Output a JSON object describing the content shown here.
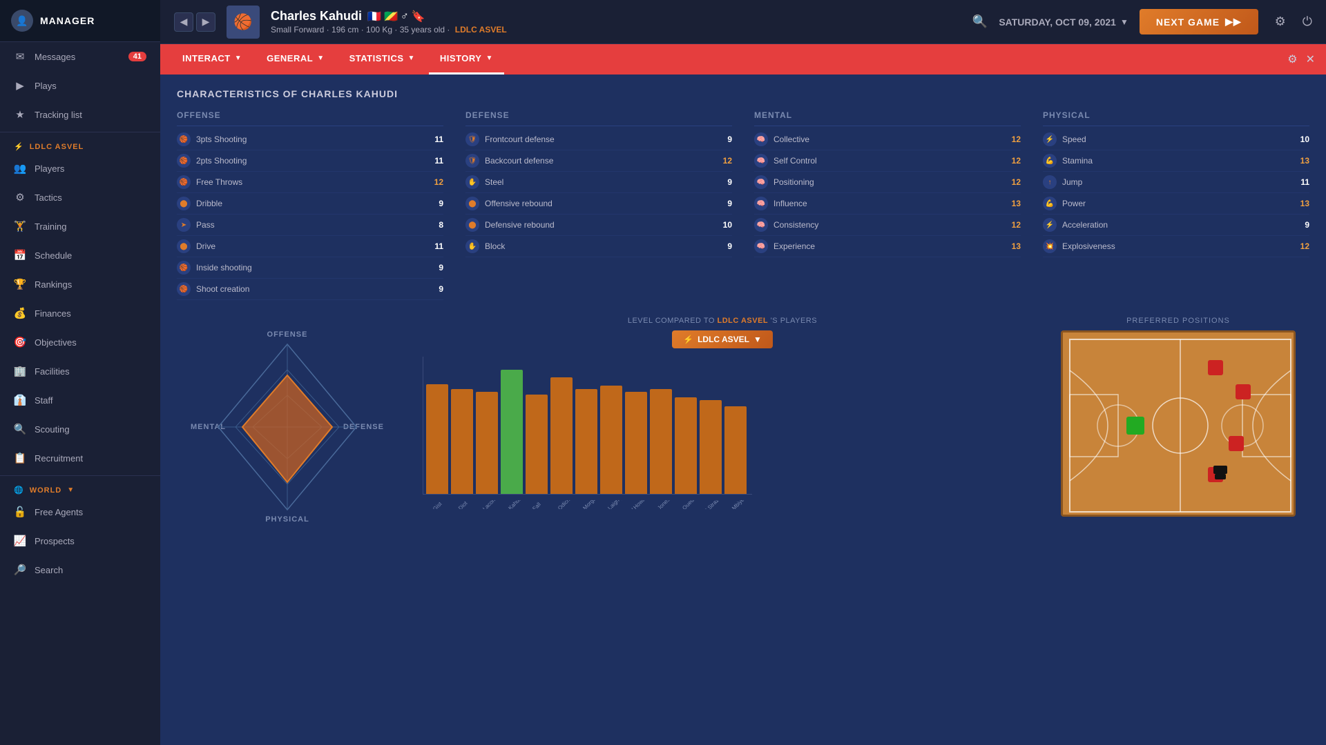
{
  "app": {
    "manager_label": "MANAGER",
    "manager_icon": "👤"
  },
  "sidebar": {
    "items": [
      {
        "id": "messages",
        "label": "Messages",
        "icon": "✉",
        "badge": "41",
        "active": false
      },
      {
        "id": "plays",
        "label": "Plays",
        "icon": "▶",
        "badge": null,
        "active": false
      },
      {
        "id": "tracking",
        "label": "Tracking list",
        "icon": "★",
        "badge": null,
        "active": false
      }
    ],
    "team_section": {
      "label": "LDLC ASVEL",
      "icon": "⚡"
    },
    "team_items": [
      {
        "id": "players",
        "label": "Players",
        "icon": "👥"
      },
      {
        "id": "tactics",
        "label": "Tactics",
        "icon": "⚙"
      },
      {
        "id": "training",
        "label": "Training",
        "icon": "🏋"
      },
      {
        "id": "schedule",
        "label": "Schedule",
        "icon": "📅"
      },
      {
        "id": "rankings",
        "label": "Rankings",
        "icon": "🏆"
      },
      {
        "id": "finances",
        "label": "Finances",
        "icon": "💰"
      },
      {
        "id": "objectives",
        "label": "Objectives",
        "icon": "🎯"
      },
      {
        "id": "facilities",
        "label": "Facilities",
        "icon": "🏢"
      },
      {
        "id": "staff",
        "label": "Staff",
        "icon": "👔"
      },
      {
        "id": "scouting",
        "label": "Scouting",
        "icon": "🔍"
      },
      {
        "id": "recruitment",
        "label": "Recruitment",
        "icon": "📋"
      }
    ],
    "world_section": {
      "label": "WORLD",
      "icon": "🌐"
    },
    "world_items": [
      {
        "id": "free-agents",
        "label": "Free Agents",
        "icon": "🔓"
      },
      {
        "id": "prospects",
        "label": "Prospects",
        "icon": "📈"
      },
      {
        "id": "search",
        "label": "Search",
        "icon": "🔎"
      }
    ]
  },
  "topbar": {
    "player_name": "Charles Kahudi",
    "player_icon": "🏀",
    "player_flags": [
      "🇫🇷",
      "🇨🇬"
    ],
    "player_gender": "♂",
    "player_details": "Small Forward · 196 cm · 100 Kg · 35 years old ·",
    "player_team": "LDLC ASVEL",
    "date": "SATURDAY, OCT 09, 2021",
    "next_game_label": "NEXT GAME",
    "next_game_arrow": "▶"
  },
  "nav_tabs": [
    {
      "id": "interact",
      "label": "INTERACT",
      "active": false,
      "dropdown": true
    },
    {
      "id": "general",
      "label": "GENERAL",
      "active": false,
      "dropdown": true
    },
    {
      "id": "statistics",
      "label": "STATISTICS",
      "active": false,
      "dropdown": true
    },
    {
      "id": "history",
      "label": "HISTORY",
      "active": true,
      "dropdown": true
    }
  ],
  "content": {
    "title": "CHARACTERISTICS OF CHARLES KAHUDI",
    "offense": {
      "header": "OFFENSE",
      "stats": [
        {
          "name": "3pts Shooting",
          "value": "11"
        },
        {
          "name": "2pts Shooting",
          "value": "11"
        },
        {
          "name": "Free Throws",
          "value": "12"
        },
        {
          "name": "Dribble",
          "value": "9"
        },
        {
          "name": "Pass",
          "value": "8"
        },
        {
          "name": "Drive",
          "value": "11"
        },
        {
          "name": "Inside shooting",
          "value": "9"
        },
        {
          "name": "Shoot creation",
          "value": "9"
        }
      ]
    },
    "defense": {
      "header": "DEFENSE",
      "stats": [
        {
          "name": "Frontcourt defense",
          "value": "9"
        },
        {
          "name": "Backcourt defense",
          "value": "12"
        },
        {
          "name": "Steel",
          "value": "9"
        },
        {
          "name": "Offensive rebound",
          "value": "9"
        },
        {
          "name": "Defensive rebound",
          "value": "10"
        },
        {
          "name": "Block",
          "value": "9"
        }
      ]
    },
    "mental": {
      "header": "MENTAL",
      "stats": [
        {
          "name": "Collective",
          "value": "12"
        },
        {
          "name": "Self Control",
          "value": "12"
        },
        {
          "name": "Positioning",
          "value": "12"
        },
        {
          "name": "Influence",
          "value": "13"
        },
        {
          "name": "Consistency",
          "value": "12"
        },
        {
          "name": "Experience",
          "value": "13"
        }
      ]
    },
    "physical": {
      "header": "PHYSICAL",
      "stats": [
        {
          "name": "Speed",
          "value": "10"
        },
        {
          "name": "Stamina",
          "value": "13"
        },
        {
          "name": "Jump",
          "value": "11"
        },
        {
          "name": "Power",
          "value": "13"
        },
        {
          "name": "Acceleration",
          "value": "9"
        },
        {
          "name": "Explosiveness",
          "value": "12"
        }
      ]
    },
    "chart": {
      "title_prefix": "LEVEL COMPARED TO",
      "team_highlight": "LDLC ASVEL",
      "title_suffix": "'S PLAYERS",
      "team_label": "LDLC ASVEL",
      "players": [
        "J.Gist",
        "A.Diot",
        "P.Lacombe",
        "C.Kahudi",
        "Y.Fall",
        "B.Odicho",
        "R.Morgan",
        "D.Laighty",
        "W.Howard",
        "C.Jones",
        "D.Ouedraogo",
        "M.Strazel",
        "B.Mbiye"
      ],
      "bars": [
        75,
        72,
        70,
        85,
        68,
        80,
        72,
        74,
        70,
        72,
        66,
        64,
        60
      ],
      "highlight_index": 3
    },
    "diamond": {
      "offense_label": "OFFENSE",
      "defense_label": "DEFENSE",
      "mental_label": "MENTAL",
      "physical_label": "PHYSICAL"
    },
    "positions": {
      "title": "PREFERRED POSITIONS"
    }
  }
}
